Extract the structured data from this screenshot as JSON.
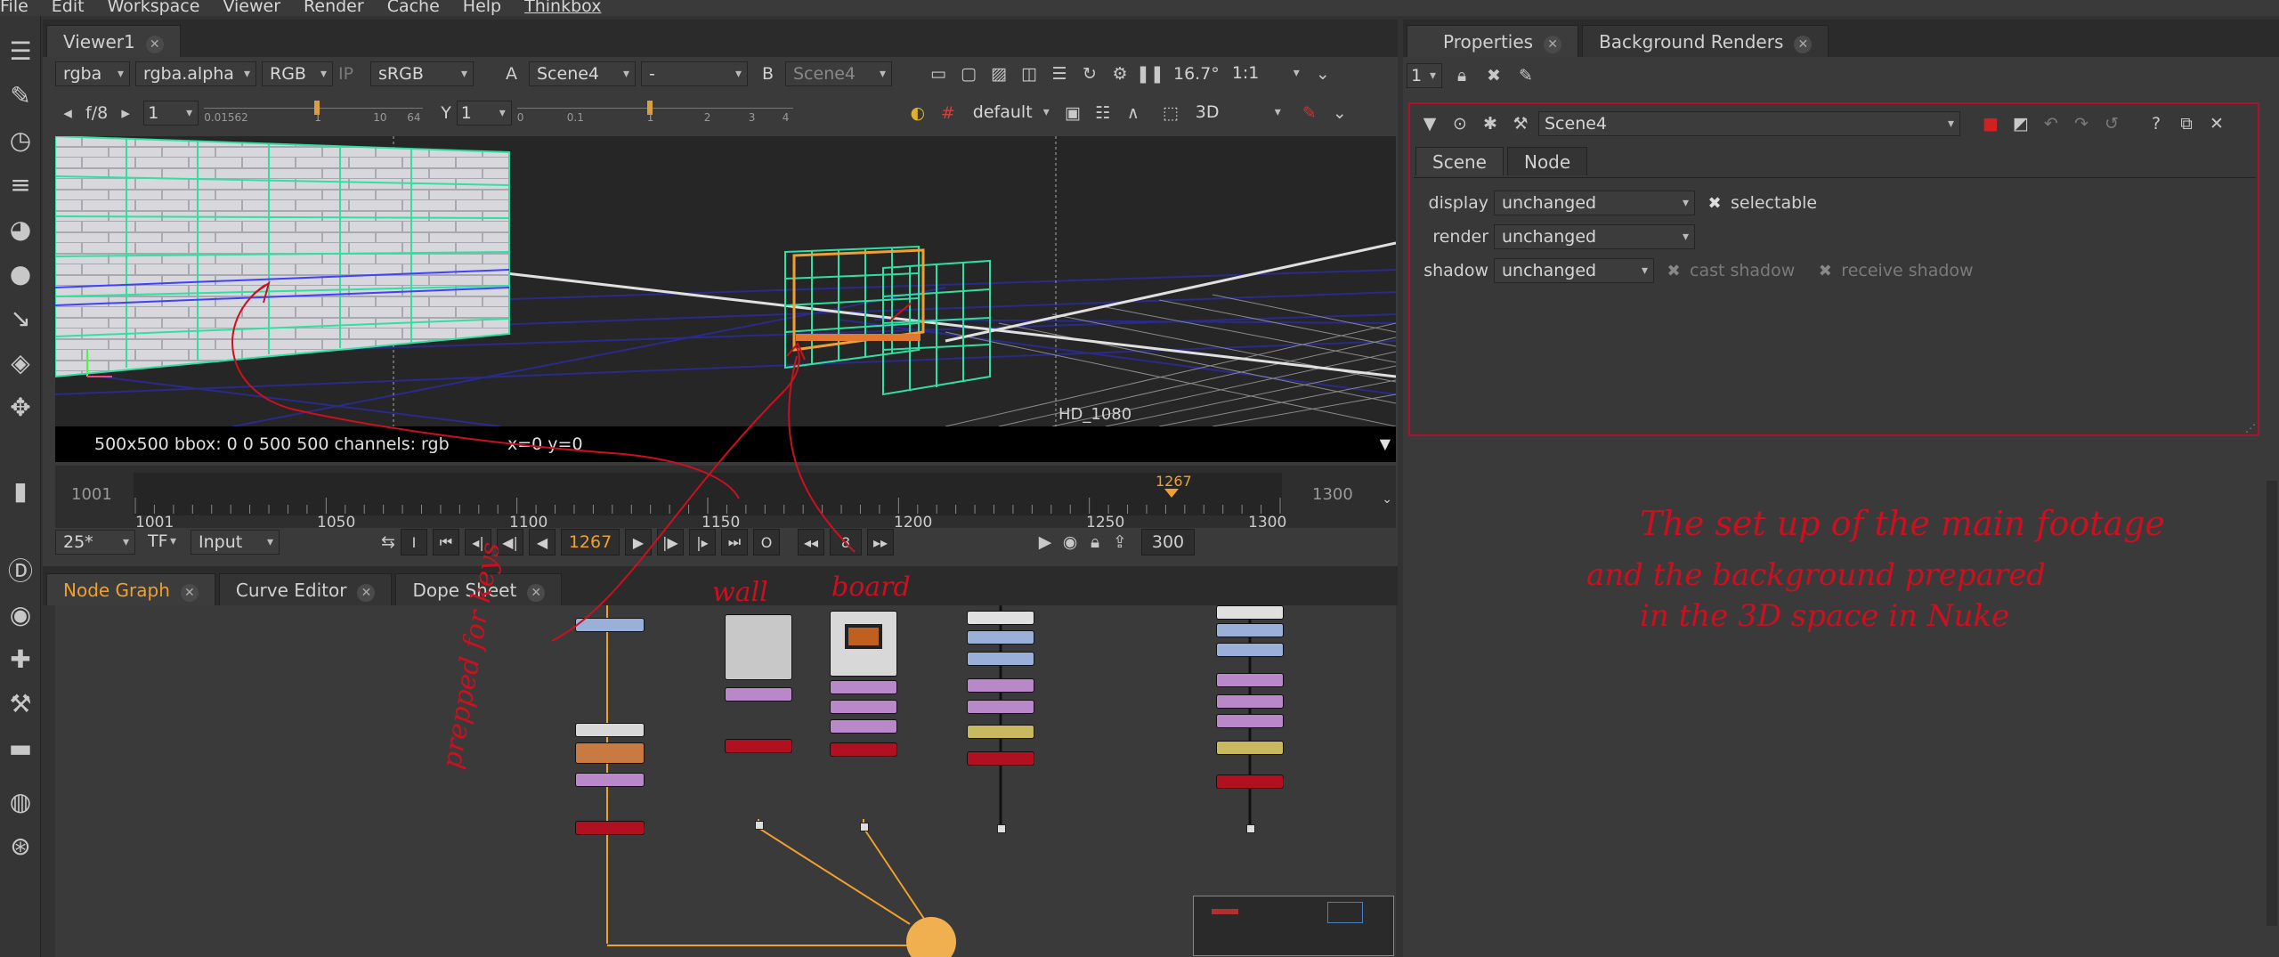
{
  "menu": [
    "File",
    "Edit",
    "Workspace",
    "Viewer",
    "Render",
    "Cache",
    "Help",
    "Thinkbox"
  ],
  "viewer": {
    "tab": "Viewer1",
    "channels": "rgba",
    "alpha": "rgba.alpha",
    "colorspace": "RGB",
    "ip": "IP",
    "lut": "sRGB",
    "a_label": "A",
    "a_input": "Scene4",
    "a_op": "-",
    "b_label": "B",
    "b_input": "Scene4",
    "zoom": "16.7°",
    "ratio": "1:1",
    "fstop": "f/8",
    "gain": "1",
    "y_label": "Y",
    "gamma": "1",
    "gain_ticks": [
      "0.01562",
      "1",
      "10",
      "64"
    ],
    "gamma_ticks": [
      "0",
      "0.1",
      "1",
      "2",
      "3",
      "4"
    ],
    "camera": "default",
    "mode": "3D",
    "format_label": "HD_1080",
    "status_info": "500x500  bbox: 0 0 500 500 channels: rgb",
    "coords": "x=0 y=0"
  },
  "timeline": {
    "start": "1001",
    "end": "1300",
    "ticks": [
      "1001",
      "1050",
      "1100",
      "1150",
      "1200",
      "1250",
      "1300"
    ],
    "current": "1267",
    "fps": "25*",
    "tf": "TF",
    "input": "Input",
    "increment": "8",
    "frame_end": "300",
    "i_label": "I",
    "o_label": "O"
  },
  "graph_tabs": [
    {
      "label": "Node Graph",
      "active": true
    },
    {
      "label": "Curve Editor",
      "active": false
    },
    {
      "label": "Dope Sheet",
      "active": false
    }
  ],
  "props": {
    "tabs": [
      "Properties",
      "Background Renders"
    ],
    "max_panels": "1",
    "node_name": "Scene4",
    "subtabs": [
      "Scene",
      "Node"
    ],
    "display_label": "display",
    "display_value": "unchanged",
    "selectable": "selectable",
    "render_label": "render",
    "render_value": "unchanged",
    "shadow_label": "shadow",
    "shadow_value": "unchanged",
    "cast_shadow": "cast shadow",
    "receive_shadow": "receive shadow"
  },
  "annotations": {
    "wall": "wall",
    "board": "board",
    "prepped": "prepped for keys",
    "line1": "The set up of the main footage",
    "line2": "and the background prepared",
    "line3": "in the   3D space  in Nuke"
  },
  "colors": {
    "accent_orange": "#f0a030",
    "annotation_red": "#cc1020",
    "wire_green": "#40e0a0"
  }
}
